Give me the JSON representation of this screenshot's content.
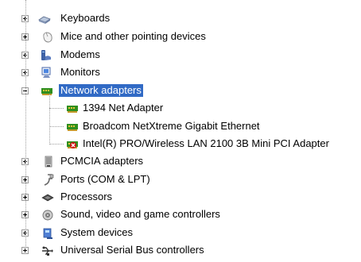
{
  "tree": {
    "items": [
      {
        "label": "Keyboards",
        "icon": "keyboard-icon",
        "expanded": false,
        "selected": false
      },
      {
        "label": "Mice and other pointing devices",
        "icon": "mouse-icon",
        "expanded": false,
        "selected": false
      },
      {
        "label": "Modems",
        "icon": "modem-icon",
        "expanded": false,
        "selected": false
      },
      {
        "label": "Monitors",
        "icon": "monitor-icon",
        "expanded": false,
        "selected": false
      },
      {
        "label": "Network adapters",
        "icon": "network-adapter-icon",
        "expanded": true,
        "selected": true,
        "children": [
          {
            "label": "1394 Net Adapter",
            "icon": "network-adapter-icon",
            "disabled": false
          },
          {
            "label": "Broadcom NetXtreme Gigabit Ethernet",
            "icon": "network-adapter-icon",
            "disabled": false
          },
          {
            "label": "Intel(R) PRO/Wireless LAN 2100 3B Mini PCI Adapter",
            "icon": "network-adapter-disabled-icon",
            "disabled": true
          }
        ]
      },
      {
        "label": "PCMCIA adapters",
        "icon": "pcmcia-icon",
        "expanded": false,
        "selected": false
      },
      {
        "label": "Ports (COM & LPT)",
        "icon": "port-icon",
        "expanded": false,
        "selected": false
      },
      {
        "label": "Processors",
        "icon": "processor-icon",
        "expanded": false,
        "selected": false
      },
      {
        "label": "Sound, video and game controllers",
        "icon": "sound-icon",
        "expanded": false,
        "selected": false
      },
      {
        "label": "System devices",
        "icon": "system-device-icon",
        "expanded": false,
        "selected": false
      },
      {
        "label": "Universal Serial Bus controllers",
        "icon": "usb-icon",
        "expanded": false,
        "selected": false
      }
    ]
  },
  "colors": {
    "selection_bg": "#316ac5",
    "selection_text": "#ffffff",
    "tree_line": "#a0a0a0",
    "adapter_green": "#2f8f1f",
    "disabled_red": "#d21010"
  }
}
